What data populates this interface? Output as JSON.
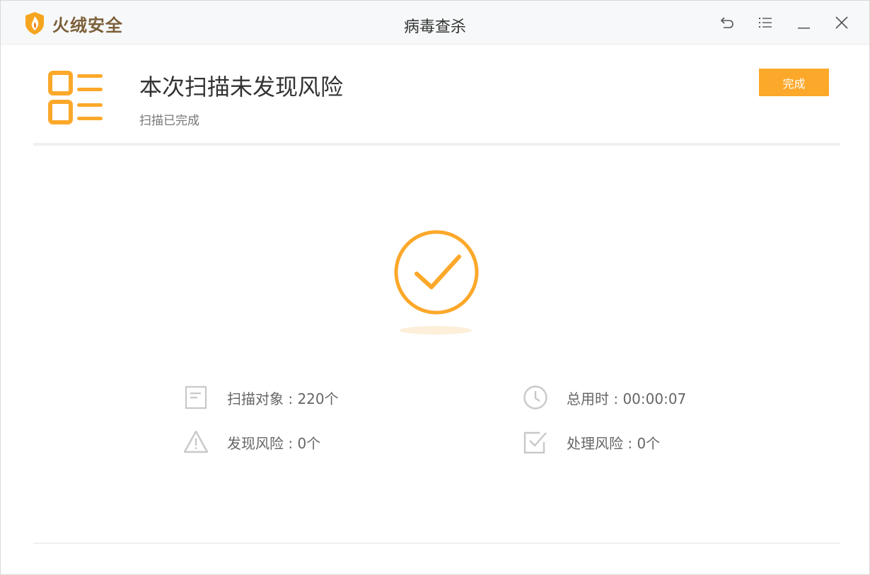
{
  "window": {
    "brand_name": "火绒安全",
    "title": "病毒查杀",
    "controls": [
      "back-icon",
      "menu-icon",
      "minimize-icon",
      "close-icon"
    ]
  },
  "summary": {
    "title": "本次扫描未发现风险",
    "subtitle": "扫描已完成",
    "done_label": "完成"
  },
  "stats": {
    "scanned_label": "扫描对象 : 220个",
    "time_label": "总用时 : 00:00:07",
    "risks_found_label": "发现风险 : 0个",
    "risks_handled_label": "处理风险 : 0个"
  },
  "colors": {
    "accent": "#fca82a",
    "brand_text": "#7b5f3a",
    "icon_gray": "#c8c8c8"
  }
}
